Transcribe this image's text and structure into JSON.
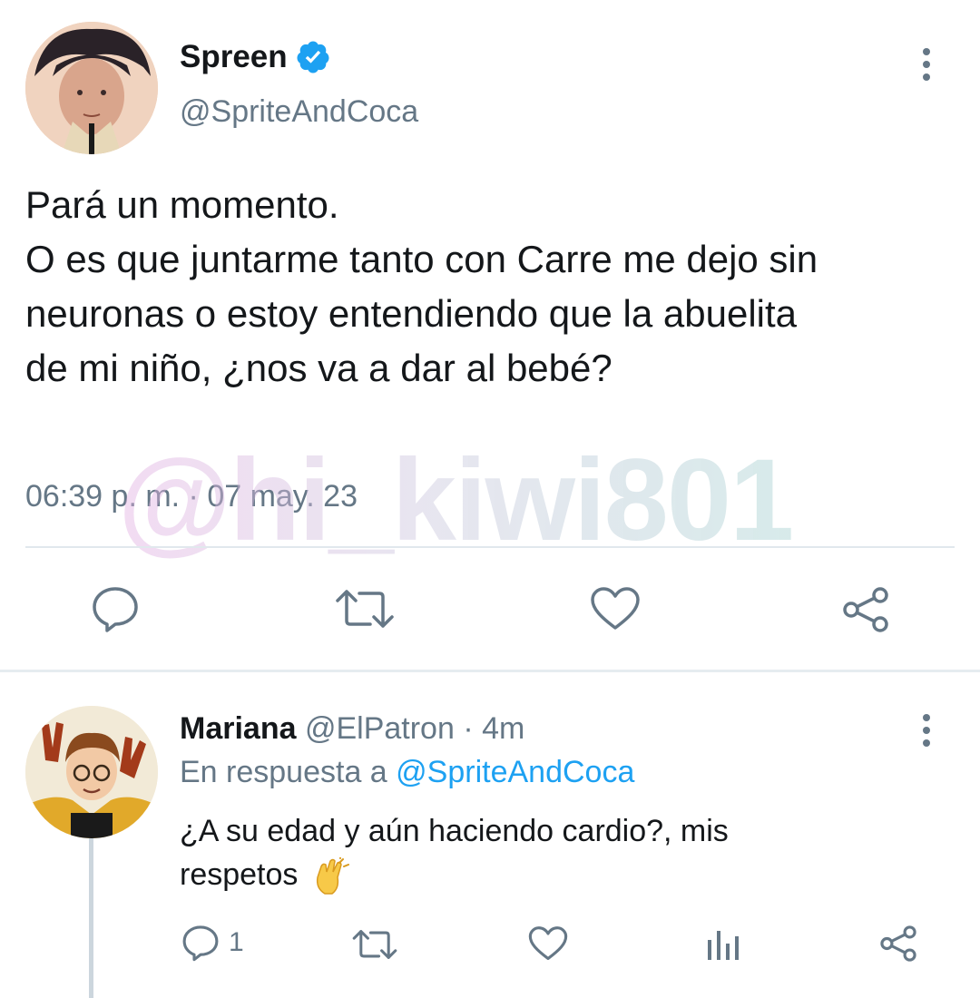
{
  "main_tweet": {
    "display_name": "Spreen",
    "verified": true,
    "handle": "@SpriteAndCoca",
    "text_lines": [
      "Pará un momento.",
      "O es que juntarme tanto con Carre me dejo sin",
      "neuronas o estoy entendiendo que la abuelita",
      "de mi niño, ¿nos va a dar al bebé?"
    ],
    "timestamp": "06:39 p. m. · 07 may. 23",
    "actions": [
      "reply-icon",
      "retweet-icon",
      "like-icon",
      "share-icon"
    ]
  },
  "watermark": "@hi_kiwi801",
  "reply_tweet": {
    "display_name": "Mariana",
    "handle": "@ElPatron",
    "separator": "·",
    "time": "4m",
    "in_reply_prefix": "En respuesta a",
    "in_reply_handle": "@SpriteAndCoca",
    "text_line1": "¿A su edad y aún haciendo cardio?, mis",
    "text_line2": "respetos",
    "emoji": "👏",
    "reply_count": "1",
    "actions": [
      "reply-icon",
      "retweet-icon",
      "like-icon",
      "analytics-icon",
      "share-icon"
    ]
  },
  "colors": {
    "accent": "#1da1f2",
    "muted": "#657786",
    "divider": "#e1e8ed"
  }
}
